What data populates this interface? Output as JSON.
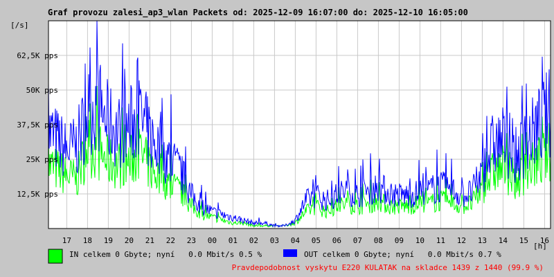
{
  "chart_data": {
    "type": "line",
    "title": "Graf provozu zalesi_ap3_wlan Packets od: 2025-12-09 16:07:00 do: 2025-12-10 16:05:00",
    "ylabel": "[/s]",
    "xlabel": "[h]",
    "ylim": [
      0,
      75
    ],
    "yunit": "K pps",
    "yticks": [
      "12,5K pps",
      "25K pps",
      "37,5K pps",
      "50K pps",
      "62,5K pps"
    ],
    "ytick_values": [
      12.5,
      25,
      37.5,
      50,
      62.5
    ],
    "xticks": [
      "17",
      "18",
      "19",
      "20",
      "21",
      "22",
      "23",
      "00",
      "01",
      "02",
      "03",
      "04",
      "05",
      "06",
      "07",
      "08",
      "09",
      "10",
      "11",
      "12",
      "13",
      "14",
      "15",
      "16"
    ],
    "x_hours_from_start": [
      0,
      0.88,
      1.38,
      1.88,
      2.38,
      2.88,
      3.38,
      3.88,
      4.38,
      4.88,
      5.38,
      5.88,
      6.38,
      6.88,
      7.38,
      7.88,
      8.38,
      8.88,
      9.38,
      9.88,
      10.38,
      10.88,
      11.38,
      11.88,
      12.38,
      12.88,
      13.38,
      13.88,
      14.38,
      14.88,
      15.38,
      15.88,
      16.38,
      16.88,
      17.38,
      17.88,
      18.38,
      18.88,
      19.38,
      19.88,
      20.38,
      20.88,
      21.38,
      21.88,
      22.38,
      22.88,
      23.38,
      23.88,
      24.15
    ],
    "series": [
      {
        "name": "OUT",
        "color": "#0000ff",
        "values": [
          35,
          28,
          30,
          42,
          45,
          38,
          35,
          37,
          40,
          33,
          28,
          25,
          20,
          12,
          8,
          6,
          5,
          4,
          3,
          2,
          2,
          1,
          1,
          3,
          10,
          12,
          10,
          12,
          14,
          12,
          14,
          15,
          13,
          12,
          12,
          13,
          14,
          15,
          14,
          12,
          13,
          20,
          30,
          32,
          25,
          30,
          35,
          40,
          42
        ]
      },
      {
        "name": "IN",
        "color": "#00ff00",
        "values": [
          23,
          19,
          18,
          30,
          28,
          24,
          23,
          24,
          27,
          22,
          18,
          16,
          13,
          8,
          5,
          4,
          3,
          2,
          2,
          1,
          1,
          1,
          1,
          2,
          6,
          8,
          6,
          8,
          9,
          8,
          9,
          10,
          8,
          8,
          8,
          9,
          9,
          10,
          9,
          8,
          9,
          14,
          20,
          22,
          16,
          20,
          23,
          26,
          28
        ]
      }
    ]
  },
  "legend": {
    "in_label": "IN celkem 0 Gbyte; nyní   0.0 Mbit/s 0.5 %",
    "out_label": "OUT celkem 0 Gbyte; nyní   0.0 Mbit/s 0.7 %"
  },
  "footer_note": "Pravdepodobnost vyskytu E220 KULATAK na skladce 1439 z 1440 (99.9 %)",
  "colors": {
    "in": "#00ff00",
    "out": "#0000ff",
    "note": "#ff0000"
  }
}
